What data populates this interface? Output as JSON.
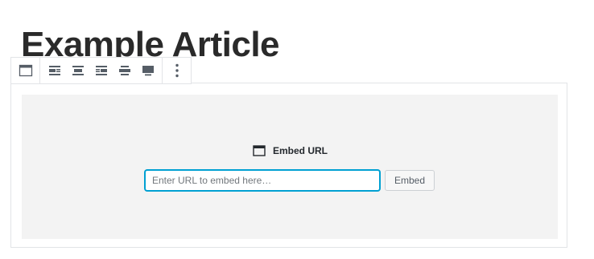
{
  "post": {
    "title": "Example Article"
  },
  "toolbar": {
    "block_icon": "embed-block-icon",
    "alignments": [
      {
        "icon": "align-left-icon"
      },
      {
        "icon": "align-center-icon"
      },
      {
        "icon": "align-right-icon"
      },
      {
        "icon": "align-wide-icon"
      },
      {
        "icon": "align-full-width-icon"
      }
    ],
    "more_icon": "vertical-ellipsis-icon"
  },
  "embed": {
    "label": "Embed URL",
    "label_icon": "browser-window-icon",
    "url_value": "",
    "url_placeholder": "Enter URL to embed here…",
    "button_label": "Embed"
  },
  "colors": {
    "focus": "#00a0d2",
    "placeholder_bg": "#f3f3f3",
    "border": "#e2e4e7"
  }
}
